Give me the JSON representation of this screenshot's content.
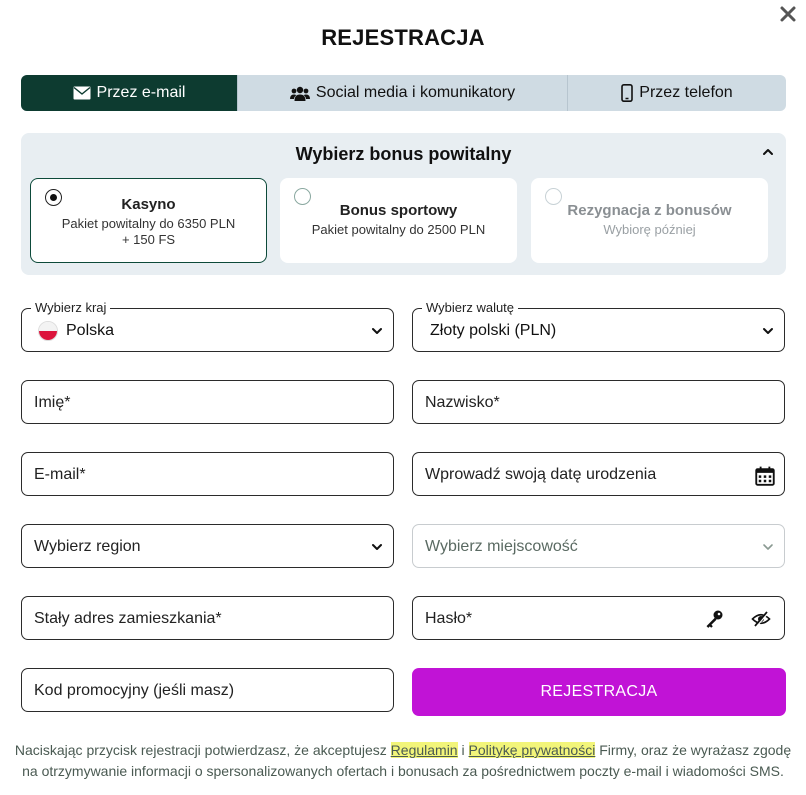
{
  "title": "REJESTRACJA",
  "tabs": [
    {
      "label": "Przez e-mail",
      "icon": "envelope-icon",
      "active": true
    },
    {
      "label": "Social media i komunikatory",
      "icon": "users-icon",
      "active": false
    },
    {
      "label": "Przez telefon",
      "icon": "phone-icon",
      "active": false
    }
  ],
  "bonus": {
    "title": "Wybierz bonus powitalny",
    "options": [
      {
        "name": "Kasyno",
        "desc_line1": "Pakiet powitalny do 6350 PLN",
        "desc_line2": "+ 150 FS",
        "selected": true
      },
      {
        "name": "Bonus sportowy",
        "desc_line1": "Pakiet powitalny do 2500 PLN",
        "selected": false
      },
      {
        "name": "Rezygnacja z bonusów",
        "desc_line1": "Wybiorę później",
        "selected": false
      }
    ]
  },
  "form": {
    "country": {
      "legend": "Wybierz kraj",
      "value": "Polska"
    },
    "currency": {
      "legend": "Wybierz walutę",
      "value": "Złoty polski (PLN)"
    },
    "first_name": "Imię*",
    "last_name": "Nazwisko*",
    "email": "E-mail*",
    "birth_date": "Wprowadź swoją datę urodzenia",
    "region": "Wybierz region",
    "city": "Wybierz miejscowość",
    "address": "Stały adres zamieszkania*",
    "password": "Hasło*",
    "promo": "Kod promocyjny (jeśli masz)",
    "submit": "REJESTRACJA"
  },
  "terms": {
    "part1": "Naciskając przycisk rejestracji potwierdzasz, że akceptujesz ",
    "link1": "Regulamin",
    "part2": " i ",
    "link2": "Politykę prywatności",
    "part3": " Firmy, oraz że wyrażasz zgodę na otrzymywanie informacji o spersonalizowanych ofertach i bonusach za pośrednictwem poczty e-mail i wiadomości SMS."
  },
  "colors": {
    "active_tab": "#0d3b30",
    "tab_bg": "#cfdbe3",
    "submit": "#c113d6",
    "panel_bg": "#e8eef2"
  }
}
